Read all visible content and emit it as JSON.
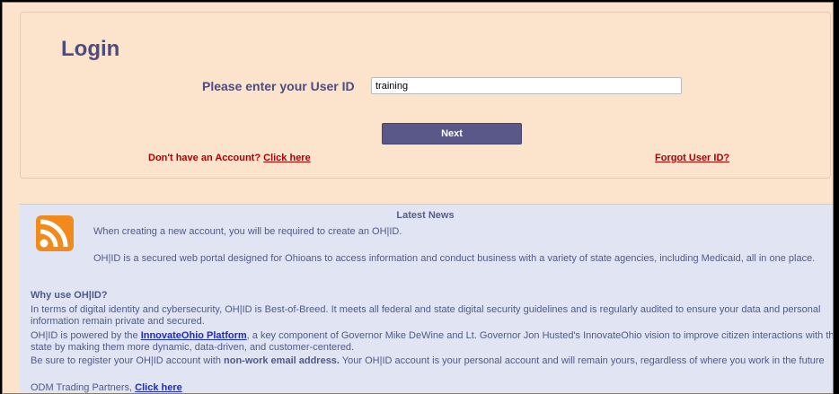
{
  "login": {
    "title": "Login",
    "userid_label": "Please enter your User ID",
    "userid_value": "training",
    "next_label": "Next",
    "no_account_text": "Don't have an Account?",
    "click_here": "Click here",
    "forgot_label": "Forgot User ID?"
  },
  "news": {
    "title": "Latest News",
    "icon": "rss-icon",
    "p1": "When creating a new account, you will be required to create an OH|ID.",
    "p2": "OH|ID is a secured web portal designed for Ohioans to access information and conduct business with a variety of state agencies, including Medicaid, all in one place.",
    "why_title": "Why use OH|ID?",
    "p3": "In terms of digital identity and cybersecurity, OH|ID is Best-of-Breed. It meets all federal and state digital security guidelines and is regularly audited to ensure your data and personal information remain private and secured.",
    "p4_before": "OH|ID is powered by the ",
    "p4_link": "InnovateOhio Platform",
    "p4_after": ", a key component of Governor Mike DeWine and Lt. Governor Jon Husted's InnovateOhio vision to improve citizen interactions with the state by making them more dynamic, data-driven, and customer-centered.",
    "p5_before": "Be sure to register your OH|ID account with ",
    "p5_bold": "non-work email address.",
    "p5_after": " Your OH|ID account is your personal account and will remain yours, regardless of where you work in the future",
    "p6_before": "ODM Trading Partners, ",
    "p6_link": "Click here"
  },
  "colors": {
    "background": "#fce3cc",
    "accent": "#4d4b80",
    "button": "#5a5888",
    "link_red": "#b00000",
    "news_bg": "#e1e4f2",
    "rss": "#f08a1c"
  }
}
